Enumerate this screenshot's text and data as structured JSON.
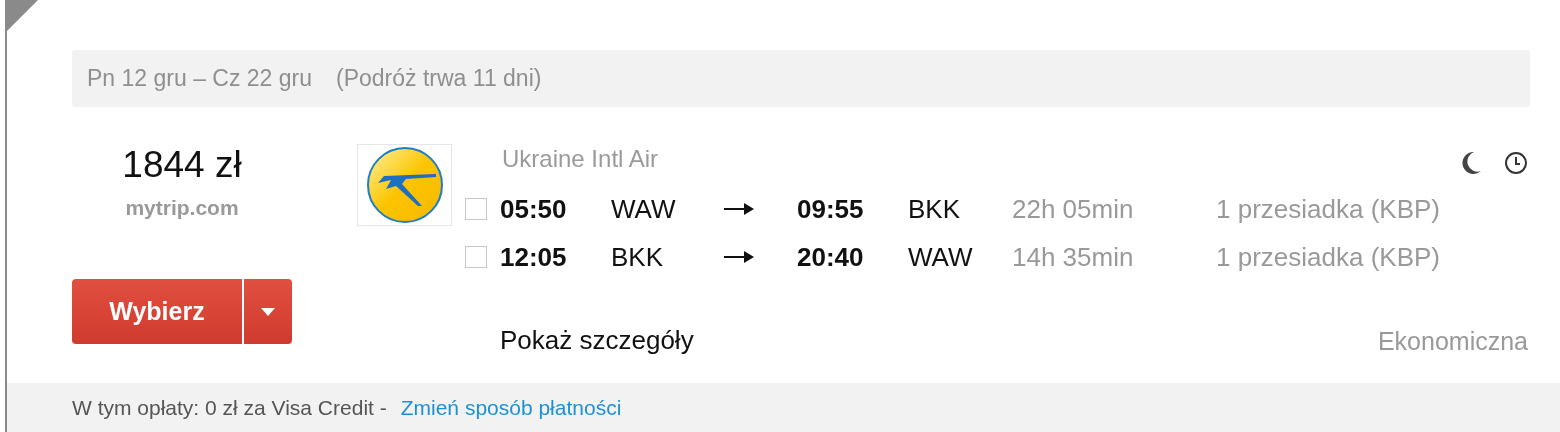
{
  "dates": {
    "range": "Pn 12 gru – Cz 22 gru",
    "duration": "(Podróż trwa 11 dni)"
  },
  "price": {
    "amount": "1844 zł",
    "provider": "mytrip.com"
  },
  "select_button": {
    "label": "Wybierz"
  },
  "airline": "Ukraine Intl Air",
  "flights": [
    {
      "checked": false,
      "depart": "05:50",
      "from": "WAW",
      "arrive": "09:55",
      "to": "BKK",
      "duration": "22h 05min",
      "stops": "1 przesiadka (KBP)"
    },
    {
      "checked": false,
      "depart": "12:05",
      "from": "BKK",
      "arrive": "20:40",
      "to": "WAW",
      "duration": "14h 35min",
      "stops": "1 przesiadka (KBP)"
    }
  ],
  "details_link": "Pokaż szczegóły",
  "cabin_class": "Ekonomiczna",
  "footer": {
    "text": "W tym opłaty: 0 zł za Visa Credit -",
    "link": "Zmień sposób płatności"
  }
}
